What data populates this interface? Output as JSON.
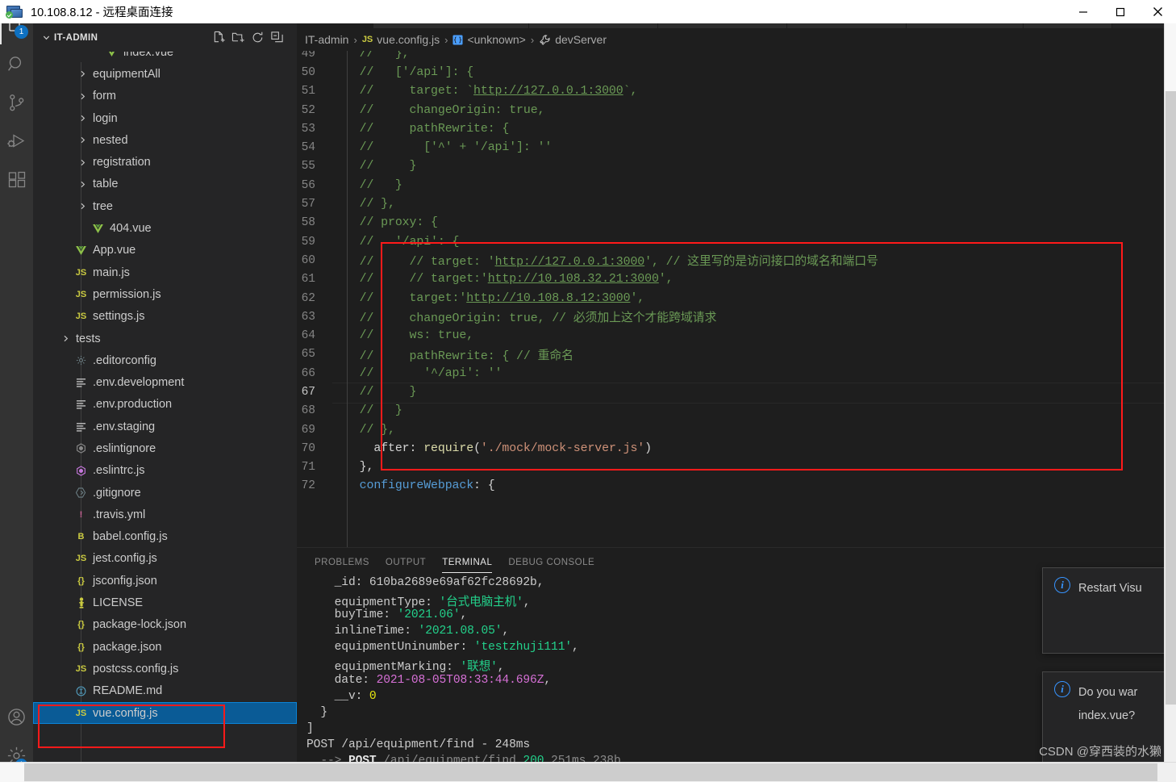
{
  "window": {
    "title": "10.108.8.12 - 远程桌面连接",
    "icon": "remote-desktop-icon",
    "controls": {
      "minimize": "minimize",
      "maximize": "maximize",
      "close": "close"
    }
  },
  "activity_bar": {
    "items": [
      {
        "name": "explorer",
        "icon": "files-icon",
        "badge": "1",
        "active": true
      },
      {
        "name": "search",
        "icon": "search-icon",
        "badge": "",
        "active": false
      },
      {
        "name": "source-control",
        "icon": "source-control-icon",
        "badge": "",
        "active": false
      },
      {
        "name": "run-and-debug",
        "icon": "run-debug-icon",
        "badge": "",
        "active": false
      },
      {
        "name": "extensions",
        "icon": "extensions-icon",
        "badge": "",
        "active": false
      }
    ],
    "bottom_items": [
      {
        "name": "accounts",
        "icon": "account-icon",
        "badge": ""
      },
      {
        "name": "manage",
        "icon": "gear-icon",
        "badge": "1"
      }
    ]
  },
  "sidebar": {
    "title": "IT-ADMIN",
    "collapse_icon": "chevron-down-icon",
    "actions": [
      {
        "name": "new-file",
        "icon": "new-file-icon"
      },
      {
        "name": "new-folder",
        "icon": "new-folder-icon"
      },
      {
        "name": "refresh",
        "icon": "refresh-icon"
      },
      {
        "name": "collapse-all",
        "icon": "collapse-all-icon"
      }
    ],
    "tree": [
      {
        "label": "index.vue",
        "kind": "vue",
        "indent": 3,
        "twisty": "",
        "clipped": true
      },
      {
        "label": "equipmentAll",
        "kind": "folder",
        "indent": 2,
        "twisty": "right"
      },
      {
        "label": "form",
        "kind": "folder",
        "indent": 2,
        "twisty": "right"
      },
      {
        "label": "login",
        "kind": "folder",
        "indent": 2,
        "twisty": "right"
      },
      {
        "label": "nested",
        "kind": "folder",
        "indent": 2,
        "twisty": "right"
      },
      {
        "label": "registration",
        "kind": "folder",
        "indent": 2,
        "twisty": "right"
      },
      {
        "label": "table",
        "kind": "folder",
        "indent": 2,
        "twisty": "right"
      },
      {
        "label": "tree",
        "kind": "folder",
        "indent": 2,
        "twisty": "right"
      },
      {
        "label": "404.vue",
        "kind": "vue",
        "indent": 2,
        "twisty": ""
      },
      {
        "label": "App.vue",
        "kind": "vue",
        "indent": 1,
        "twisty": ""
      },
      {
        "label": "main.js",
        "kind": "js",
        "indent": 1,
        "twisty": ""
      },
      {
        "label": "permission.js",
        "kind": "js",
        "indent": 1,
        "twisty": ""
      },
      {
        "label": "settings.js",
        "kind": "js",
        "indent": 1,
        "twisty": ""
      },
      {
        "label": "tests",
        "kind": "folder",
        "indent": 1,
        "twisty": "right"
      },
      {
        "label": ".editorconfig",
        "kind": "gear",
        "indent": 1,
        "twisty": ""
      },
      {
        "label": ".env.development",
        "kind": "env",
        "indent": 1,
        "twisty": ""
      },
      {
        "label": ".env.production",
        "kind": "env",
        "indent": 1,
        "twisty": ""
      },
      {
        "label": ".env.staging",
        "kind": "env",
        "indent": 1,
        "twisty": ""
      },
      {
        "label": ".eslintignore",
        "kind": "eslint",
        "indent": 1,
        "twisty": ""
      },
      {
        "label": ".eslintrc.js",
        "kind": "eslintp",
        "indent": 1,
        "twisty": ""
      },
      {
        "label": ".gitignore",
        "kind": "git",
        "indent": 1,
        "twisty": ""
      },
      {
        "label": ".travis.yml",
        "kind": "travis",
        "indent": 1,
        "twisty": ""
      },
      {
        "label": "babel.config.js",
        "kind": "babel",
        "indent": 1,
        "twisty": ""
      },
      {
        "label": "jest.config.js",
        "kind": "js",
        "indent": 1,
        "twisty": ""
      },
      {
        "label": "jsconfig.json",
        "kind": "json",
        "indent": 1,
        "twisty": ""
      },
      {
        "label": "LICENSE",
        "kind": "license",
        "indent": 1,
        "twisty": ""
      },
      {
        "label": "package-lock.json",
        "kind": "json",
        "indent": 1,
        "twisty": ""
      },
      {
        "label": "package.json",
        "kind": "json",
        "indent": 1,
        "twisty": ""
      },
      {
        "label": "postcss.config.js",
        "kind": "js",
        "indent": 1,
        "twisty": ""
      },
      {
        "label": "README.md",
        "kind": "readme",
        "indent": 1,
        "twisty": ""
      },
      {
        "label": "vue.config.js",
        "kind": "js",
        "indent": 1,
        "twisty": "",
        "selected": true
      }
    ]
  },
  "breadcrumb": {
    "parts": [
      {
        "label": "IT-admin",
        "icon": ""
      },
      {
        "label": "vue.config.js",
        "icon": "js-icon"
      },
      {
        "label": "<unknown>",
        "icon": "symbol-object-icon"
      },
      {
        "label": "devServer",
        "icon": "wrench-icon"
      }
    ],
    "separator": "›"
  },
  "code": {
    "lines": [
      {
        "n": "49",
        "segments": [
          {
            "t": "  //   },",
            "c": "cmt"
          }
        ]
      },
      {
        "n": "50",
        "segments": [
          {
            "t": "  //   ['/api']: {",
            "c": "cmt"
          }
        ]
      },
      {
        "n": "51",
        "segments": [
          {
            "t": "  //     target: `",
            "c": "cmt"
          },
          {
            "t": "http://127.0.0.1:3000",
            "c": "cmt lnk"
          },
          {
            "t": "`,",
            "c": "cmt"
          }
        ]
      },
      {
        "n": "52",
        "segments": [
          {
            "t": "  //     changeOrigin: true,",
            "c": "cmt"
          }
        ]
      },
      {
        "n": "53",
        "segments": [
          {
            "t": "  //     pathRewrite: {",
            "c": "cmt"
          }
        ]
      },
      {
        "n": "54",
        "segments": [
          {
            "t": "  //       ['^' + '/api']: ''",
            "c": "cmt"
          }
        ]
      },
      {
        "n": "55",
        "segments": [
          {
            "t": "  //     }",
            "c": "cmt"
          }
        ]
      },
      {
        "n": "56",
        "segments": [
          {
            "t": "  //   }",
            "c": "cmt"
          }
        ]
      },
      {
        "n": "57",
        "segments": [
          {
            "t": "  // },",
            "c": "cmt"
          }
        ]
      },
      {
        "n": "58",
        "segments": [
          {
            "t": "  // proxy: {",
            "c": "cmt"
          }
        ]
      },
      {
        "n": "59",
        "segments": [
          {
            "t": "  //   '/api': {",
            "c": "cmt"
          }
        ]
      },
      {
        "n": "60",
        "segments": [
          {
            "t": "  //     // target: '",
            "c": "cmt"
          },
          {
            "t": "http://127.0.0.1:3000",
            "c": "cmt lnk"
          },
          {
            "t": "', // 这里写的是访问接口的域名和端口号",
            "c": "cmt"
          }
        ]
      },
      {
        "n": "61",
        "segments": [
          {
            "t": "  //     // target:'",
            "c": "cmt"
          },
          {
            "t": "http://10.108.32.21:3000",
            "c": "cmt lnk"
          },
          {
            "t": "',",
            "c": "cmt"
          }
        ]
      },
      {
        "n": "62",
        "segments": [
          {
            "t": "  //     target:'",
            "c": "cmt"
          },
          {
            "t": "http://10.108.8.12:3000",
            "c": "cmt lnk"
          },
          {
            "t": "',",
            "c": "cmt"
          }
        ]
      },
      {
        "n": "63",
        "segments": [
          {
            "t": "  //     changeOrigin: true, // 必须加上这个才能跨域请求",
            "c": "cmt"
          }
        ]
      },
      {
        "n": "64",
        "segments": [
          {
            "t": "  //     ws: true,",
            "c": "cmt"
          }
        ]
      },
      {
        "n": "65",
        "segments": [
          {
            "t": "  //     pathRewrite: { // 重命名",
            "c": "cmt"
          }
        ]
      },
      {
        "n": "66",
        "segments": [
          {
            "t": "  //       '^/api': ''",
            "c": "cmt"
          }
        ]
      },
      {
        "n": "67",
        "segments": [
          {
            "t": "  //     }",
            "c": "cmt"
          }
        ],
        "current": true
      },
      {
        "n": "68",
        "segments": [
          {
            "t": "  //   }",
            "c": "cmt"
          }
        ]
      },
      {
        "n": "69",
        "segments": [
          {
            "t": "  // },",
            "c": "cmt"
          }
        ]
      },
      {
        "n": "70",
        "segments": [
          {
            "t": "    after: ",
            "c": "pl"
          },
          {
            "t": "require",
            "c": "fn"
          },
          {
            "t": "(",
            "c": "pl"
          },
          {
            "t": "'./mock/mock-server.js'",
            "c": "str"
          },
          {
            "t": ")",
            "c": "pl"
          }
        ]
      },
      {
        "n": "71",
        "segments": [
          {
            "t": "  },",
            "c": "pl"
          }
        ]
      },
      {
        "n": "72",
        "segments": [
          {
            "t": "  ",
            "c": "pl"
          },
          {
            "t": "configureWebpack",
            "c": "kw"
          },
          {
            "t": ": {",
            "c": "pl"
          }
        ]
      }
    ]
  },
  "panel": {
    "tabs": [
      {
        "label": "PROBLEMS",
        "active": false
      },
      {
        "label": "OUTPUT",
        "active": false
      },
      {
        "label": "TERMINAL",
        "active": true
      },
      {
        "label": "DEBUG CONSOLE",
        "active": false
      }
    ],
    "terminal_lines": [
      [
        {
          "t": "    _id: 610ba2689e69af62fc28692b,",
          "c": ""
        }
      ],
      [
        {
          "t": "    equipmentType: ",
          "c": ""
        },
        {
          "t": "'台式电脑主机'",
          "c": "t-green"
        },
        {
          "t": ",",
          "c": ""
        }
      ],
      [
        {
          "t": "    buyTime: ",
          "c": ""
        },
        {
          "t": "'2021.06'",
          "c": "t-green"
        },
        {
          "t": ",",
          "c": ""
        }
      ],
      [
        {
          "t": "    inlineTime: ",
          "c": ""
        },
        {
          "t": "'2021.08.05'",
          "c": "t-green"
        },
        {
          "t": ",",
          "c": ""
        }
      ],
      [
        {
          "t": "    equipmentUninumber: ",
          "c": ""
        },
        {
          "t": "'testzhuji111'",
          "c": "t-green"
        },
        {
          "t": ",",
          "c": ""
        }
      ],
      [
        {
          "t": "    equipmentMarking: ",
          "c": ""
        },
        {
          "t": "'联想'",
          "c": "t-green"
        },
        {
          "t": ",",
          "c": ""
        }
      ],
      [
        {
          "t": "    date: ",
          "c": ""
        },
        {
          "t": "2021-08-05T08:33:44.696Z",
          "c": "t-mag"
        },
        {
          "t": ",",
          "c": ""
        }
      ],
      [
        {
          "t": "    __v: ",
          "c": ""
        },
        {
          "t": "0",
          "c": "t-yel"
        }
      ],
      [
        {
          "t": "  }",
          "c": ""
        }
      ],
      [
        {
          "t": "]",
          "c": ""
        }
      ],
      [
        {
          "t": "POST /api/equipment/find - 248ms",
          "c": ""
        }
      ],
      [
        {
          "t": "  --> ",
          "c": "t-dim"
        },
        {
          "t": "POST",
          "c": "t-bold"
        },
        {
          "t": " /api/equipment/find ",
          "c": "t-dim"
        },
        {
          "t": "200",
          "c": "t-num"
        },
        {
          "t": " 251ms 238b",
          "c": "t-dim"
        }
      ]
    ]
  },
  "notifications": [
    {
      "icon": "info-icon",
      "line1": "Restart Visu",
      "line2": ""
    },
    {
      "icon": "info-icon",
      "line1": "Do you war",
      "line2": "index.vue?"
    }
  ],
  "watermark": "CSDN @穿西装的水獭",
  "colors": {
    "accent": "#0e70c0",
    "selection": "#0a5b96",
    "annotation": "#ff1a1a",
    "comment": "#6a9955",
    "terminal_green": "#23d18b"
  }
}
